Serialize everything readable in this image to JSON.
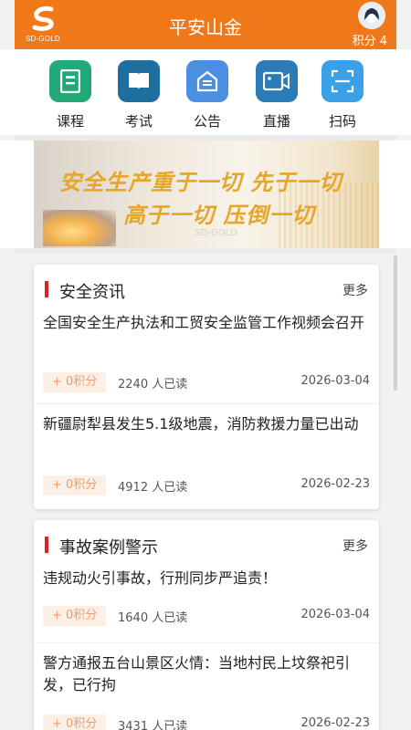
{
  "header": {
    "title": "平安山金",
    "logo_text": "SD-GOLD",
    "points_label": "积分 4"
  },
  "quick_actions": [
    {
      "label": "课程",
      "icon": "book-list-icon",
      "color": "#23a878"
    },
    {
      "label": "考试",
      "icon": "open-book-icon",
      "color": "#1e6fa0"
    },
    {
      "label": "公告",
      "icon": "announcement-icon",
      "color": "#4a8fe0"
    },
    {
      "label": "直播",
      "icon": "video-camera-icon",
      "color": "#2a7bb8"
    },
    {
      "label": "扫码",
      "icon": "scan-icon",
      "color": "#3aa0e8"
    }
  ],
  "banner": {
    "line1": "安全生产重于一切 先于一切",
    "line2": "高于一切 压倒一切",
    "watermark": "SD-GOLD"
  },
  "sections": [
    {
      "title": "安全资讯",
      "more": "更多",
      "items": [
        {
          "title": "全国安全生产执法和工贸安全监管工作视频会召开",
          "points": "+ 0积分",
          "reads": "2240 人已读",
          "date": "2026-03-04"
        },
        {
          "title": "新疆尉犁县发生5.1级地震，消防救援力量已出动",
          "points": "+ 0积分",
          "reads": "4912 人已读",
          "date": "2026-02-23"
        }
      ]
    },
    {
      "title": "事故案例警示",
      "more": "更多",
      "items": [
        {
          "title": "违规动火引事故，行刑同步严追责！",
          "points": "+ 0积分",
          "reads": "1640 人已读",
          "date": "2026-03-04"
        },
        {
          "title": "警方通报五台山景区火情：当地村民上坟祭祀引发，已行拘",
          "points": "+ 0积分",
          "reads": "3431 人已读",
          "date": "2026-02-23"
        }
      ]
    }
  ],
  "colors": {
    "header_bg": "#f07818",
    "accent_bar": "#e02020",
    "banner_text": "#e4a72a"
  }
}
